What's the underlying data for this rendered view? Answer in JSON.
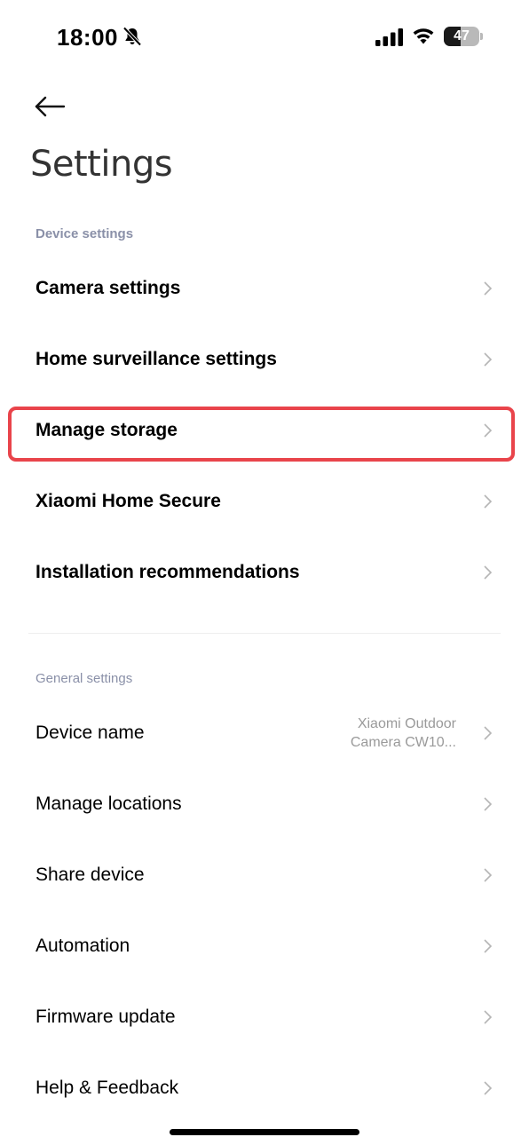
{
  "status_bar": {
    "time": "18:00",
    "battery_level": "47",
    "battery_fraction": 0.47,
    "icons": [
      "bell-off-icon",
      "signal-icon",
      "wifi-icon",
      "battery-icon"
    ]
  },
  "header": {
    "back_icon": "arrow-left-icon",
    "title": "Settings"
  },
  "device_settings": {
    "section_label": "Device settings",
    "items": [
      {
        "label": "Camera settings"
      },
      {
        "label": "Home surveillance settings"
      },
      {
        "label": "Manage storage",
        "highlighted": true
      },
      {
        "label": "Xiaomi Home Secure"
      },
      {
        "label": "Installation recommendations"
      }
    ]
  },
  "general_settings": {
    "section_label": "General settings",
    "items": [
      {
        "label": "Device name",
        "value_line1": "Xiaomi Outdoor",
        "value_line2": "Camera CW10..."
      },
      {
        "label": "Manage locations"
      },
      {
        "label": "Share device"
      },
      {
        "label": "Automation"
      },
      {
        "label": "Firmware update"
      },
      {
        "label": "Help & Feedback"
      }
    ]
  },
  "colors": {
    "highlight": "#e9444b",
    "section_header": "#8a90a8",
    "chevron": "#b5b5b5"
  }
}
